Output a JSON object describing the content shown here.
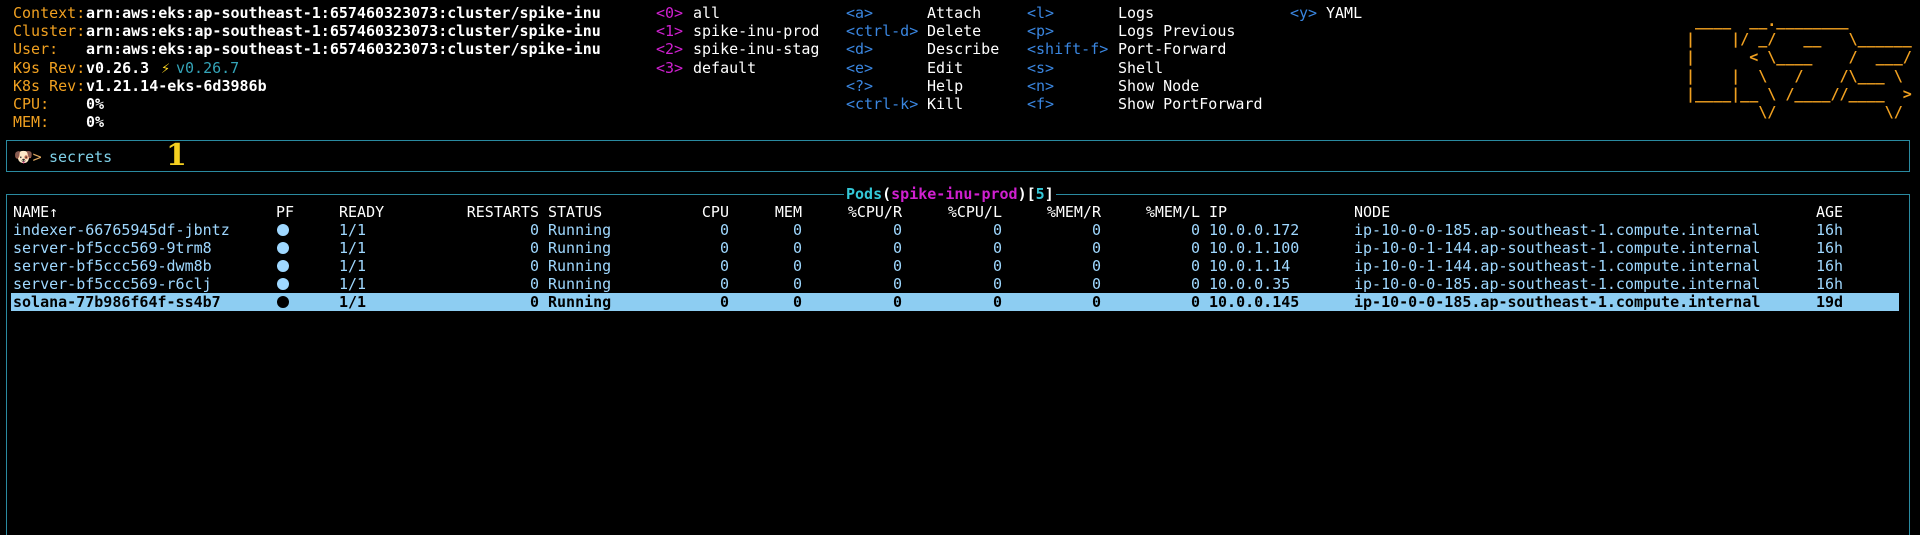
{
  "info": {
    "rows": [
      {
        "label": "Context:",
        "value": "arn:aws:eks:ap-southeast-1:657460323073:cluster/spike-inu"
      },
      {
        "label": "Cluster:",
        "value": "arn:aws:eks:ap-southeast-1:657460323073:cluster/spike-inu"
      },
      {
        "label": "User:",
        "value": "arn:aws:eks:ap-southeast-1:657460323073:cluster/spike-inu"
      },
      {
        "label": "K9s Rev:",
        "value": "v0.26.3",
        "bolt": "⚡",
        "latest": "v0.26.7"
      },
      {
        "label": "K8s Rev:",
        "value": "v1.21.14-eks-6d3986b"
      },
      {
        "label": "CPU:",
        "value": "0%"
      },
      {
        "label": "MEM:",
        "value": "0%"
      }
    ]
  },
  "namespaces": [
    {
      "key": "<0>",
      "label": "all"
    },
    {
      "key": "<1>",
      "label": "spike-inu-prod"
    },
    {
      "key": "<2>",
      "label": "spike-inu-stag"
    },
    {
      "key": "<3>",
      "label": "default"
    }
  ],
  "commands_col1": [
    {
      "key": "<a>",
      "label": "Attach"
    },
    {
      "key": "<ctrl-d>",
      "label": "Delete"
    },
    {
      "key": "<d>",
      "label": "Describe"
    },
    {
      "key": "<e>",
      "label": "Edit"
    },
    {
      "key": "<?>",
      "label": "Help"
    },
    {
      "key": "<ctrl-k>",
      "label": "Kill"
    }
  ],
  "commands_col2": [
    {
      "key": "<l>",
      "label": "Logs"
    },
    {
      "key": "<p>",
      "label": "Logs Previous"
    },
    {
      "key": "<shift-f>",
      "label": "Port-Forward"
    },
    {
      "key": "<s>",
      "label": "Shell"
    },
    {
      "key": "<n>",
      "label": "Show Node"
    },
    {
      "key": "<f>",
      "label": "Show PortForward"
    }
  ],
  "commands_col3": [
    {
      "key": "<y>",
      "label": "YAML"
    }
  ],
  "logo": [
    " ____  __.________       ",
    "|    |/ _/   __   \\______",
    "|      < \\____    /  ___/",
    "|    |  \\   /    /\\___ \\ ",
    "|____|__ \\ /____//____  >",
    "        \\/            \\/ "
  ],
  "prompt": {
    "icon": "🐶>",
    "text": "secrets",
    "marker": "1"
  },
  "table": {
    "resource": "Pods",
    "namespace": "spike-inu-prod",
    "count": "5",
    "columns": {
      "name": "NAME↑",
      "pf": "PF",
      "ready": "READY",
      "restarts": "RESTARTS",
      "status": "STATUS",
      "cpu": "CPU",
      "mem": "MEM",
      "cpu_r": "%CPU/R",
      "cpu_l": "%CPU/L",
      "mem_r": "%MEM/R",
      "mem_l": "%MEM/L",
      "ip": "IP",
      "node": "NODE",
      "age": "AGE"
    },
    "rows": [
      {
        "name": "indexer-66765945df-jbntz",
        "ready": "1/1",
        "restarts": "0",
        "status": "Running",
        "cpu": "0",
        "mem": "0",
        "cpu_r": "0",
        "cpu_l": "0",
        "mem_r": "0",
        "mem_l": "0",
        "ip": "10.0.0.172",
        "node": "ip-10-0-0-185.ap-southeast-1.compute.internal",
        "age": "16h"
      },
      {
        "name": "server-bf5ccc569-9trm8",
        "ready": "1/1",
        "restarts": "0",
        "status": "Running",
        "cpu": "0",
        "mem": "0",
        "cpu_r": "0",
        "cpu_l": "0",
        "mem_r": "0",
        "mem_l": "0",
        "ip": "10.0.1.100",
        "node": "ip-10-0-1-144.ap-southeast-1.compute.internal",
        "age": "16h"
      },
      {
        "name": "server-bf5ccc569-dwm8b",
        "ready": "1/1",
        "restarts": "0",
        "status": "Running",
        "cpu": "0",
        "mem": "0",
        "cpu_r": "0",
        "cpu_l": "0",
        "mem_r": "0",
        "mem_l": "0",
        "ip": "10.0.1.14",
        "node": "ip-10-0-1-144.ap-southeast-1.compute.internal",
        "age": "16h"
      },
      {
        "name": "server-bf5ccc569-r6clj",
        "ready": "1/1",
        "restarts": "0",
        "status": "Running",
        "cpu": "0",
        "mem": "0",
        "cpu_r": "0",
        "cpu_l": "0",
        "mem_r": "0",
        "mem_l": "0",
        "ip": "10.0.0.35",
        "node": "ip-10-0-0-185.ap-southeast-1.compute.internal",
        "age": "16h"
      },
      {
        "name": "solana-77b986f64f-ss4b7",
        "ready": "1/1",
        "restarts": "0",
        "status": "Running",
        "cpu": "0",
        "mem": "0",
        "cpu_r": "0",
        "cpu_l": "0",
        "mem_r": "0",
        "mem_l": "0",
        "ip": "10.0.0.145",
        "node": "ip-10-0-0-185.ap-southeast-1.compute.internal",
        "age": "19d",
        "selected": true
      }
    ]
  },
  "colors": {
    "accent": "#2a8aa0",
    "label": "#f0a020",
    "namespace_key": "#d020d0",
    "command_key": "#3a86e0",
    "row_text": "#9fd8ff",
    "selected_bg": "#8dcdf2"
  }
}
